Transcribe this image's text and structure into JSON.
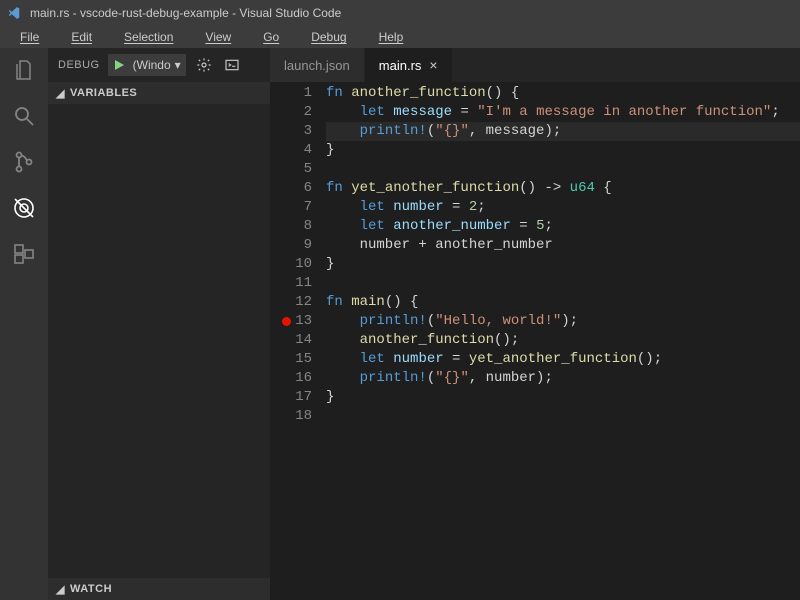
{
  "title": "main.rs - vscode-rust-debug-example - Visual Studio Code",
  "menu": {
    "file": "File",
    "edit": "Edit",
    "selection": "Selection",
    "view": "View",
    "go": "Go",
    "debug": "Debug",
    "help": "Help"
  },
  "sidebar": {
    "debug_label": "DEBUG",
    "config_name": "(Windo",
    "dropdown_caret": "▾",
    "variables_label": "VARIABLES",
    "watch_label": "WATCH",
    "twisty": "◢"
  },
  "tabs": {
    "launch": "launch.json",
    "main": "main.rs",
    "close": "×"
  },
  "code": {
    "lines": [
      {
        "n": 1,
        "html": "<span class='kw'>fn</span> <span class='fn'>another_function</span>() {"
      },
      {
        "n": 2,
        "html": "    <span class='kw'>let</span> <span class='var'>message</span> = <span class='str'>\"I'm a message in another function\"</span>;"
      },
      {
        "n": 3,
        "html": "    <span class='mac'>println!</span>(<span class='str'>\"{}\"</span>, message);",
        "hl": true
      },
      {
        "n": 4,
        "html": "}"
      },
      {
        "n": 5,
        "html": ""
      },
      {
        "n": 6,
        "html": "<span class='kw'>fn</span> <span class='fn'>yet_another_function</span>() -&gt; <span class='typ'>u64</span> {"
      },
      {
        "n": 7,
        "html": "    <span class='kw'>let</span> <span class='var'>number</span> = <span class='num'>2</span>;"
      },
      {
        "n": 8,
        "html": "    <span class='kw'>let</span> <span class='var'>another_number</span> = <span class='num'>5</span>;"
      },
      {
        "n": 9,
        "html": "    number + another_number"
      },
      {
        "n": 10,
        "html": "}"
      },
      {
        "n": 11,
        "html": ""
      },
      {
        "n": 12,
        "html": "<span class='kw'>fn</span> <span class='fn'>main</span>() {"
      },
      {
        "n": 13,
        "html": "    <span class='mac'>println!</span>(<span class='str'>\"Hello, world!\"</span>);",
        "bp": true
      },
      {
        "n": 14,
        "html": "    <span class='fn'>another_function</span>();"
      },
      {
        "n": 15,
        "html": "    <span class='kw'>let</span> <span class='var'>number</span> = <span class='fn'>yet_another_function</span>();"
      },
      {
        "n": 16,
        "html": "    <span class='mac'>println!</span>(<span class='str'>\"{}\"</span>, number);"
      },
      {
        "n": 17,
        "html": "}"
      },
      {
        "n": 18,
        "html": ""
      }
    ]
  }
}
